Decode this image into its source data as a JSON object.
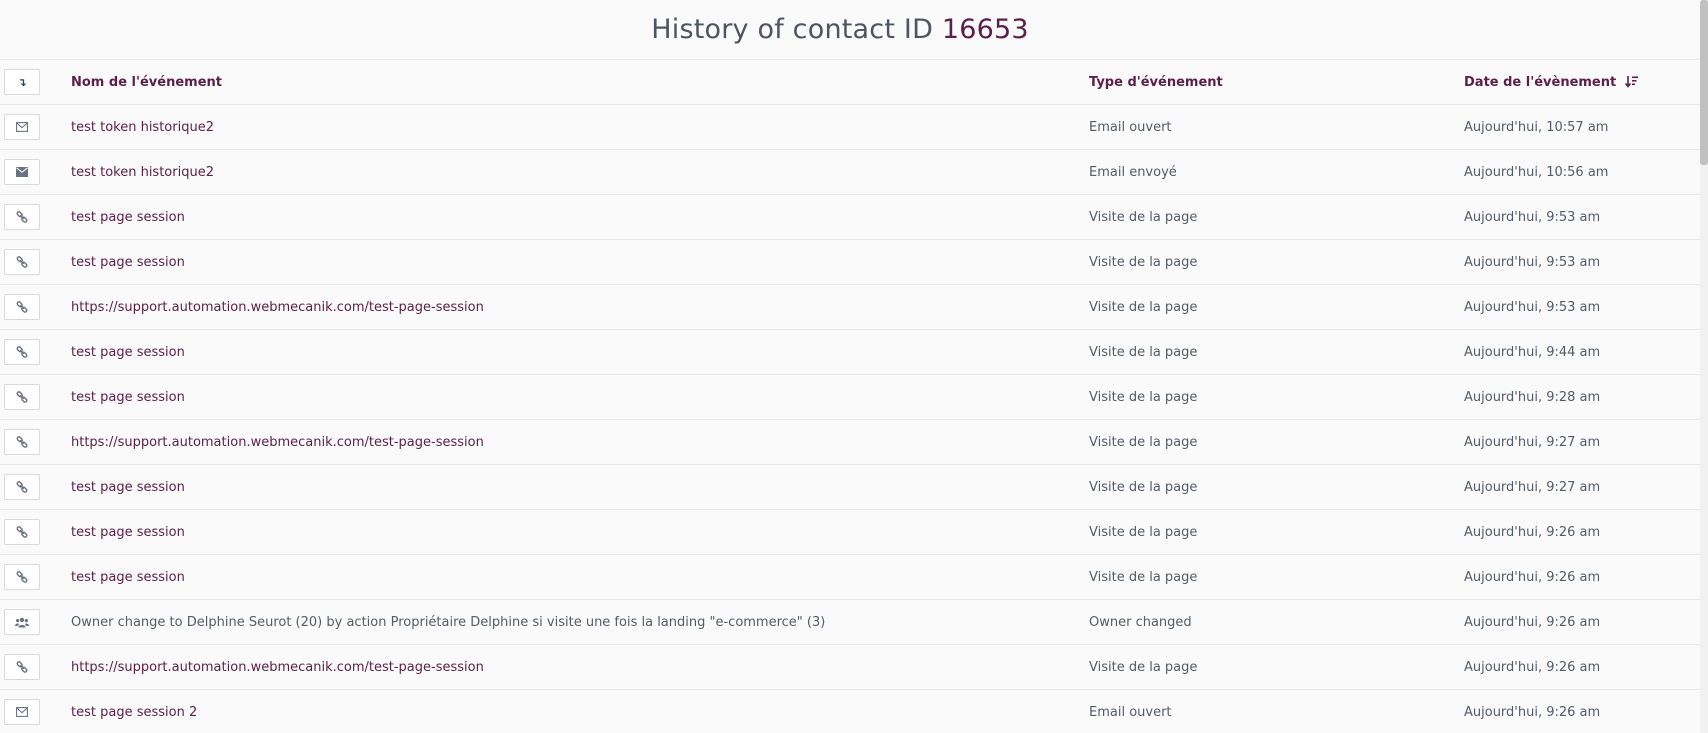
{
  "title": {
    "prefix": "History of contact ID",
    "contact_id": "16653"
  },
  "columns": {
    "toggle_glyph": "↴",
    "name": "Nom de l'événement",
    "type": "Type d'événement",
    "date": "Date de l'évènement"
  },
  "rows": [
    {
      "icon": "envelope-open-icon",
      "name": "test token historique2",
      "type": "Email ouvert",
      "date": "Aujourd'hui, 10:57 am"
    },
    {
      "icon": "envelope-icon",
      "name": "test token historique2",
      "type": "Email envoyé",
      "date": "Aujourd'hui, 10:56 am"
    },
    {
      "icon": "link-icon",
      "name": "test page session",
      "type": "Visite de la page",
      "date": "Aujourd'hui, 9:53 am"
    },
    {
      "icon": "link-icon",
      "name": "test page session",
      "type": "Visite de la page",
      "date": "Aujourd'hui, 9:53 am"
    },
    {
      "icon": "link-icon",
      "name": "https://support.automation.webmecanik.com/test-page-session",
      "type": "Visite de la page",
      "date": "Aujourd'hui, 9:53 am"
    },
    {
      "icon": "link-icon",
      "name": "test page session",
      "type": "Visite de la page",
      "date": "Aujourd'hui, 9:44 am"
    },
    {
      "icon": "link-icon",
      "name": "test page session",
      "type": "Visite de la page",
      "date": "Aujourd'hui, 9:28 am"
    },
    {
      "icon": "link-icon",
      "name": "https://support.automation.webmecanik.com/test-page-session",
      "type": "Visite de la page",
      "date": "Aujourd'hui, 9:27 am"
    },
    {
      "icon": "link-icon",
      "name": "test page session",
      "type": "Visite de la page",
      "date": "Aujourd'hui, 9:27 am"
    },
    {
      "icon": "link-icon",
      "name": "test page session",
      "type": "Visite de la page",
      "date": "Aujourd'hui, 9:26 am"
    },
    {
      "icon": "link-icon",
      "name": "test page session",
      "type": "Visite de la page",
      "date": "Aujourd'hui, 9:26 am"
    },
    {
      "icon": "users-icon",
      "name": "Owner change to Delphine Seurot (20) by action Propriétaire Delphine si visite une fois la landing \"e-commerce\" (3)",
      "type": "Owner changed",
      "date": "Aujourd'hui, 9:26 am",
      "plain": true
    },
    {
      "icon": "link-icon",
      "name": "https://support.automation.webmecanik.com/test-page-session",
      "type": "Visite de la page",
      "date": "Aujourd'hui, 9:26 am"
    },
    {
      "icon": "envelope-open-icon",
      "name": "test page session 2",
      "type": "Email ouvert",
      "date": "Aujourd'hui, 9:26 am"
    }
  ]
}
